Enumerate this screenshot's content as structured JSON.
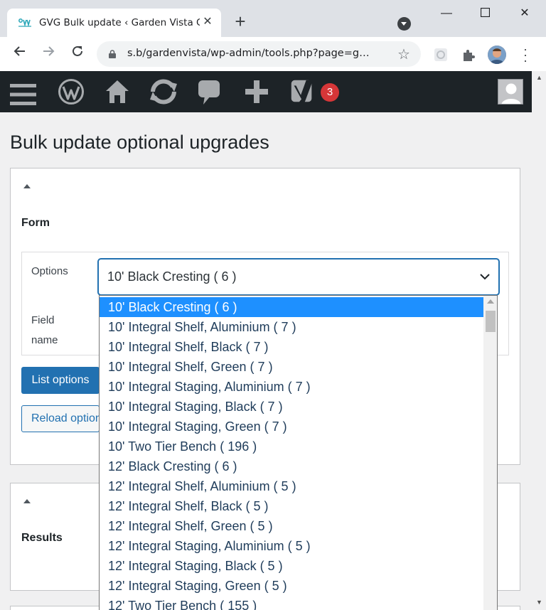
{
  "browser": {
    "tab_title": "GVG Bulk update ‹ Garden Vista G",
    "url": "s.b/gardenvista/wp-admin/tools.php?page=g…"
  },
  "adminbar": {
    "notification_count": "3"
  },
  "page": {
    "title": "Bulk update optional upgrades"
  },
  "form_box": {
    "heading": "Form",
    "options_label": "Options",
    "field_name_label_line1": "Field",
    "field_name_label_line2": "name",
    "selected_option": "10' Black Cresting ( 6 )",
    "list_options_button": "List options",
    "reload_options_button": "Reload options"
  },
  "results_box": {
    "heading": "Results"
  },
  "dropdown": {
    "options": [
      "10' Black Cresting ( 6 )",
      "10' Integral Shelf, Aluminium ( 7 )",
      "10' Integral Shelf, Black ( 7 )",
      "10' Integral Shelf, Green ( 7 )",
      "10' Integral Staging, Aluminium ( 7 )",
      "10' Integral Staging, Black ( 7 )",
      "10' Integral Staging, Green ( 7 )",
      "10' Two Tier Bench ( 196 )",
      "12' Black Cresting ( 6 )",
      "12' Integral Shelf, Aluminium ( 5 )",
      "12' Integral Shelf, Black ( 5 )",
      "12' Integral Shelf, Green ( 5 )",
      "12' Integral Staging, Aluminium ( 5 )",
      "12' Integral Staging, Black ( 5 )",
      "12' Integral Staging, Green ( 5 )",
      "12' Two Tier Bench ( 155 )"
    ]
  },
  "colors": {
    "wp_blue": "#2271b1",
    "adminbar_bg": "#1d2327",
    "badge_red": "#d63638",
    "selected_option_bg": "#1e90ff"
  }
}
